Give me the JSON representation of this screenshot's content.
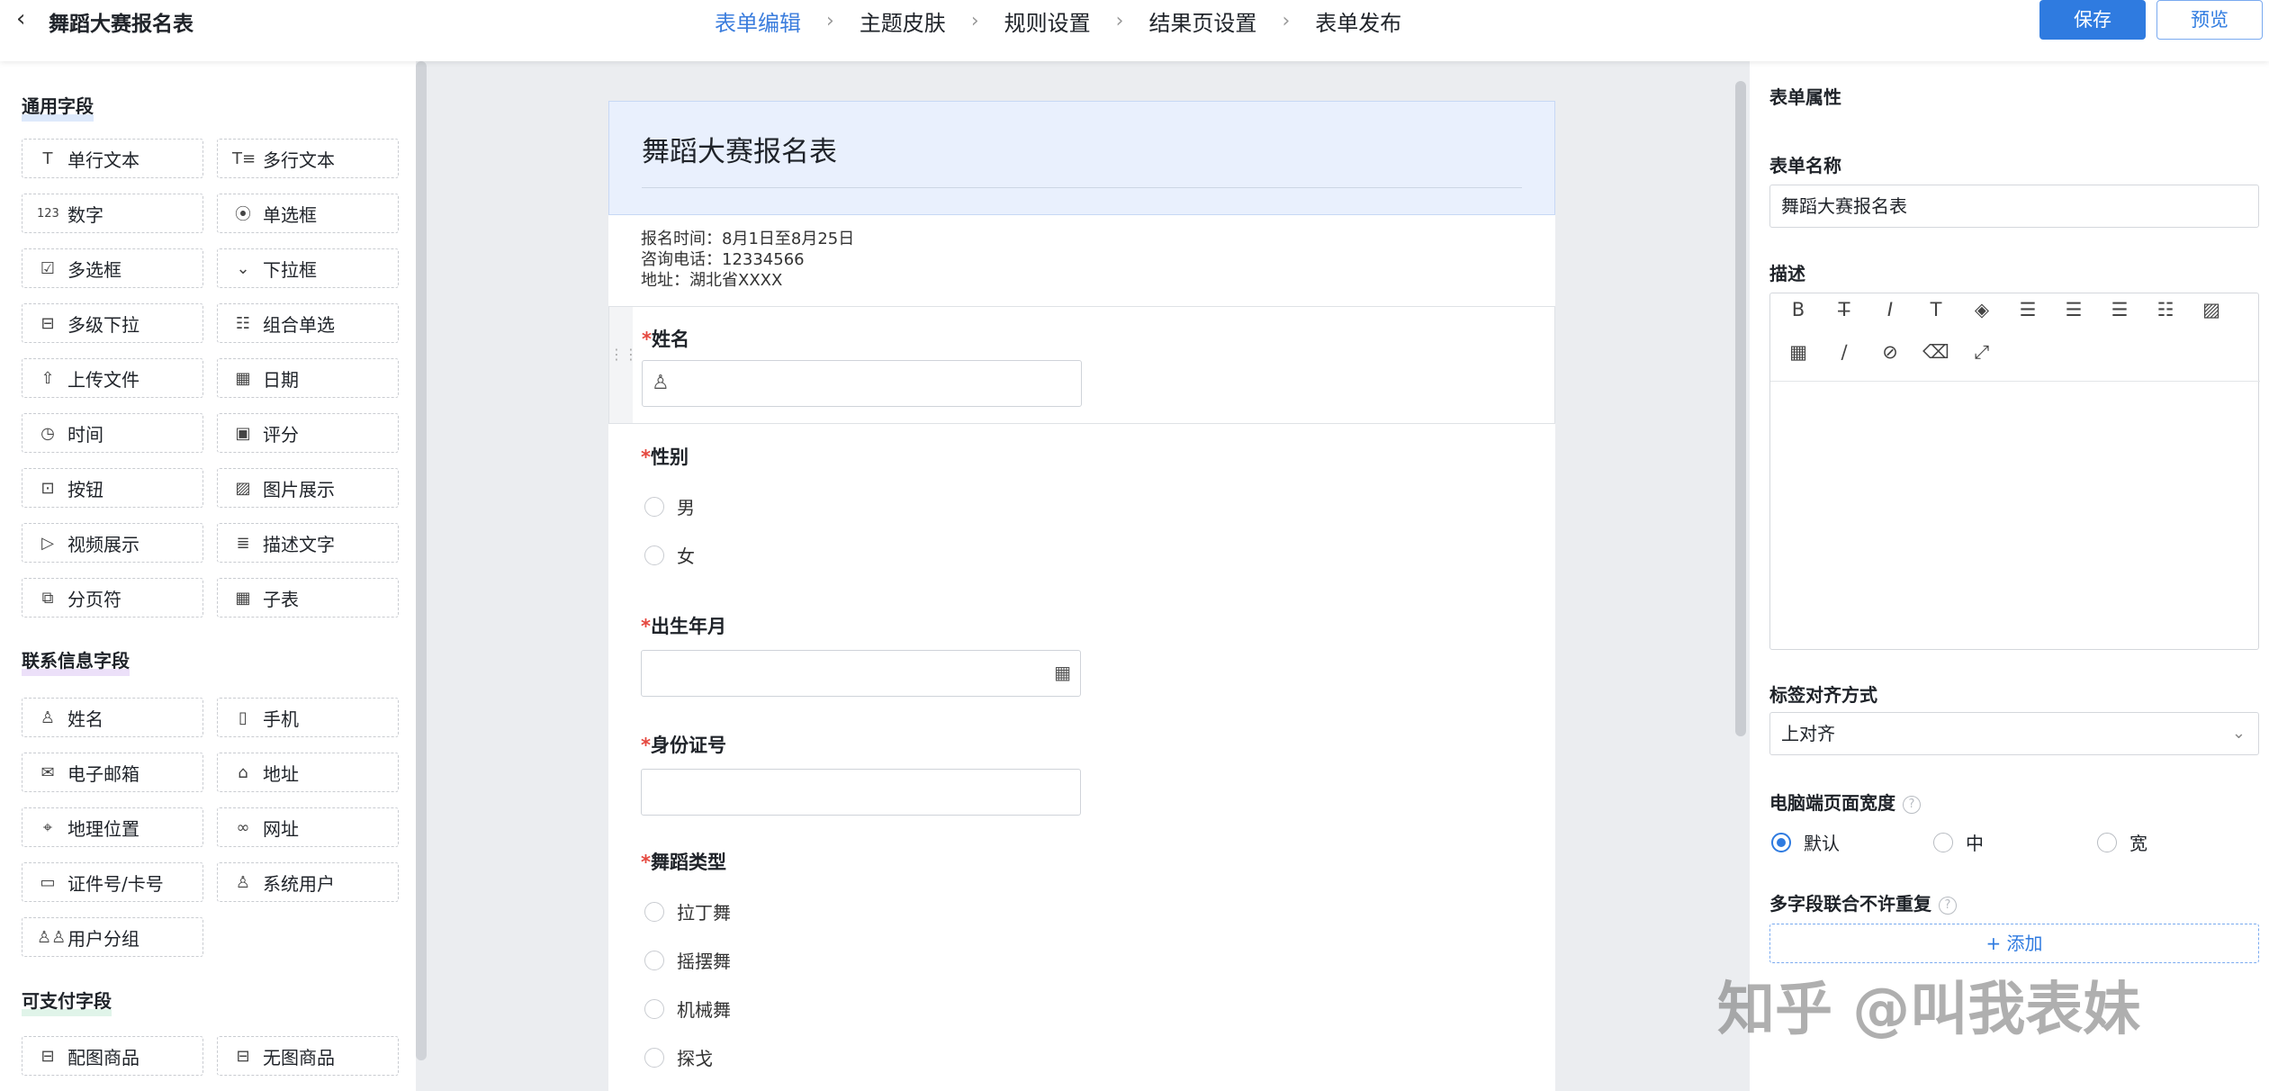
{
  "topbar": {
    "back_icon": "chevron-left-icon",
    "title": "舞蹈大赛报名表",
    "steps": [
      "表单编辑",
      "主题皮肤",
      "规则设置",
      "结果页设置",
      "表单发布"
    ],
    "active_step": 0,
    "save_label": "保存",
    "preview_label": "预览"
  },
  "colors": {
    "accent": "#2f7be0",
    "active_step": "#3b7ddd",
    "required": "#e5483f",
    "header_bg": "#e9f0fd"
  },
  "left": {
    "sections": [
      {
        "title": "通用字段",
        "highlight": "#9ec1f4",
        "fields": [
          {
            "label": "单行文本",
            "icon": "T",
            "icon_name": "single-line-text-icon"
          },
          {
            "label": "多行文本",
            "icon": "T≡",
            "icon_name": "multi-line-text-icon"
          },
          {
            "label": "数字",
            "icon": "123",
            "icon_name": "number-icon"
          },
          {
            "label": "单选框",
            "icon": "⦿",
            "icon_name": "radio-icon"
          },
          {
            "label": "多选框",
            "icon": "☑",
            "icon_name": "checkbox-icon"
          },
          {
            "label": "下拉框",
            "icon": "⌄",
            "icon_name": "dropdown-icon"
          },
          {
            "label": "多级下拉",
            "icon": "⊟",
            "icon_name": "cascade-dropdown-icon"
          },
          {
            "label": "组合单选",
            "icon": "☷",
            "icon_name": "combo-radio-icon"
          },
          {
            "label": "上传文件",
            "icon": "⇧",
            "icon_name": "upload-icon"
          },
          {
            "label": "日期",
            "icon": "▦",
            "icon_name": "calendar-icon"
          },
          {
            "label": "时间",
            "icon": "◷",
            "icon_name": "clock-icon"
          },
          {
            "label": "评分",
            "icon": "▣",
            "icon_name": "rating-icon"
          },
          {
            "label": "按钮",
            "icon": "⊡",
            "icon_name": "button-icon"
          },
          {
            "label": "图片展示",
            "icon": "▨",
            "icon_name": "image-icon"
          },
          {
            "label": "视频展示",
            "icon": "▷",
            "icon_name": "video-icon"
          },
          {
            "label": "描述文字",
            "icon": "≣",
            "icon_name": "description-icon"
          },
          {
            "label": "分页符",
            "icon": "⧉",
            "icon_name": "page-break-icon"
          },
          {
            "label": "子表",
            "icon": "▦",
            "icon_name": "subtable-icon"
          }
        ]
      },
      {
        "title": "联系信息字段",
        "highlight": "#c9a6ef",
        "fields": [
          {
            "label": "姓名",
            "icon": "♙",
            "icon_name": "person-icon"
          },
          {
            "label": "手机",
            "icon": "▯",
            "icon_name": "phone-icon"
          },
          {
            "label": "电子邮箱",
            "icon": "✉",
            "icon_name": "mail-icon"
          },
          {
            "label": "地址",
            "icon": "⌂",
            "icon_name": "home-icon"
          },
          {
            "label": "地理位置",
            "icon": "⌖",
            "icon_name": "location-icon"
          },
          {
            "label": "网址",
            "icon": "∞",
            "icon_name": "link-icon"
          },
          {
            "label": "证件号/卡号",
            "icon": "▭",
            "icon_name": "id-card-icon"
          },
          {
            "label": "系统用户",
            "icon": "♙",
            "icon_name": "system-user-icon"
          },
          {
            "label": "用户分组",
            "icon": "♙♙",
            "icon_name": "user-group-icon"
          }
        ]
      },
      {
        "title": "可支付字段",
        "highlight": "#a6e0c0",
        "fields": [
          {
            "label": "配图商品",
            "icon": "⊟",
            "icon_name": "product-image-icon"
          },
          {
            "label": "无图商品",
            "icon": "⊟",
            "icon_name": "product-noimage-icon"
          }
        ]
      }
    ]
  },
  "form": {
    "title": "舞蹈大赛报名表",
    "description_lines": [
      "报名时间：8月1日至8月25日",
      "咨询电话：12334566",
      "地址：湖北省XXXX"
    ],
    "questions": {
      "name": {
        "label": "姓名",
        "required_mark": "*",
        "icon": "♙"
      },
      "gender": {
        "label": "性别",
        "required_mark": "*",
        "options": [
          "男",
          "女"
        ]
      },
      "birth": {
        "label": "出生年月",
        "required_mark": "*",
        "icon": "▦"
      },
      "id": {
        "label": "身份证号",
        "required_mark": "*"
      },
      "dance": {
        "label": "舞蹈类型",
        "required_mark": "*",
        "options": [
          "拉丁舞",
          "摇摆舞",
          "机械舞",
          "探戈"
        ]
      }
    },
    "drag_handle": "⋮⋮"
  },
  "right": {
    "panel_title": "表单属性",
    "name_label": "表单名称",
    "name_value": "舞蹈大赛报名表",
    "desc_label": "描述",
    "toolbar_row1": [
      {
        "glyph": "B",
        "name": "bold-icon"
      },
      {
        "glyph": "T̶",
        "name": "clear-format-icon"
      },
      {
        "glyph": "I",
        "name": "italic-icon"
      },
      {
        "glyph": "T",
        "name": "strikethrough-icon"
      },
      {
        "glyph": "◈",
        "name": "fill-color-icon"
      },
      {
        "glyph": "☰",
        "name": "align-left-icon"
      },
      {
        "glyph": "☰",
        "name": "align-center-icon"
      },
      {
        "glyph": "☰",
        "name": "align-right-icon"
      },
      {
        "glyph": "☷",
        "name": "list-icon"
      },
      {
        "glyph": "▨",
        "name": "image-icon"
      }
    ],
    "toolbar_row2": [
      {
        "glyph": "▦",
        "name": "table-icon"
      },
      {
        "glyph": "∕",
        "name": "link-icon"
      },
      {
        "glyph": "⊘",
        "name": "unlink-icon"
      },
      {
        "glyph": "⌫",
        "name": "eraser-icon"
      },
      {
        "glyph": "⤢",
        "name": "fullscreen-icon"
      }
    ],
    "align_label": "标签对齐方式",
    "align_value": "上对齐",
    "width_label": "电脑端页面宽度",
    "width_options": [
      "默认",
      "中",
      "宽"
    ],
    "width_selected": 0,
    "unique_label": "多字段联合不许重复",
    "add_label": "+ 添加",
    "help_glyph": "?"
  },
  "watermark": "知乎 @叫我表妹"
}
